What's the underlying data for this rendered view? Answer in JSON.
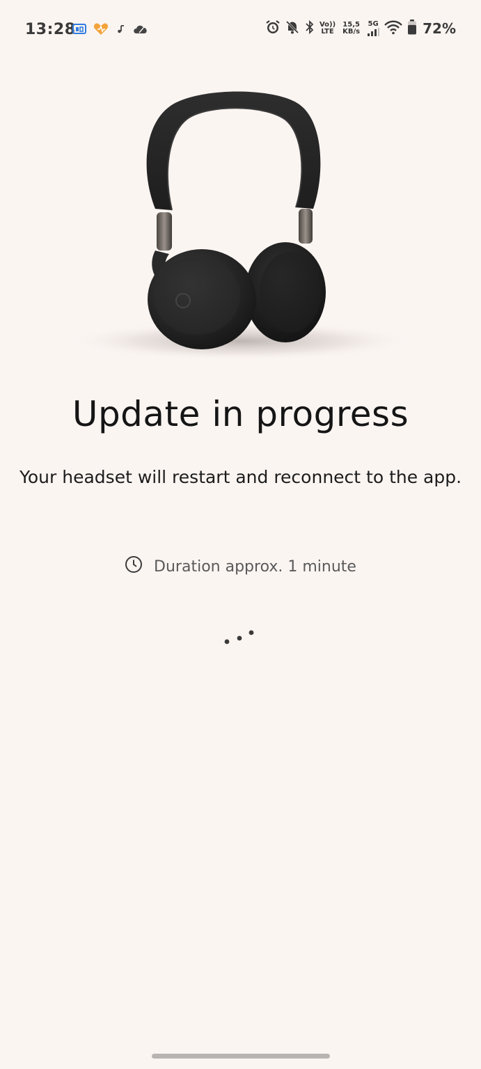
{
  "status_bar": {
    "time": "13:28",
    "volte_top": "Vo))",
    "volte_bottom": "LTE",
    "speed_value": "15,5",
    "speed_unit": "KB/s",
    "network": "5G",
    "battery_percent": "72%",
    "battery_level": 0.72,
    "left_icons": [
      "cast-icon",
      "health-heart-icon",
      "music-note-icon",
      "cloud-icon"
    ],
    "right_icons": [
      "alarm-icon",
      "mute-bell-icon",
      "bluetooth-icon",
      "signal-icon",
      "wifi-icon",
      "battery-icon"
    ]
  },
  "main": {
    "hero_image": "headphones-image",
    "title": "Update in progress",
    "subtitle": "Your headset will restart and reconnect to the app.",
    "duration_text": "Duration approx. 1 minute",
    "duration_icon": "clock-icon"
  },
  "colors": {
    "background": "#fbf5f2",
    "text": "#1c1c1c",
    "muted_text": "#5a5a5a",
    "accent_blue": "#2f7be0",
    "accent_orange": "#f2a33a"
  }
}
